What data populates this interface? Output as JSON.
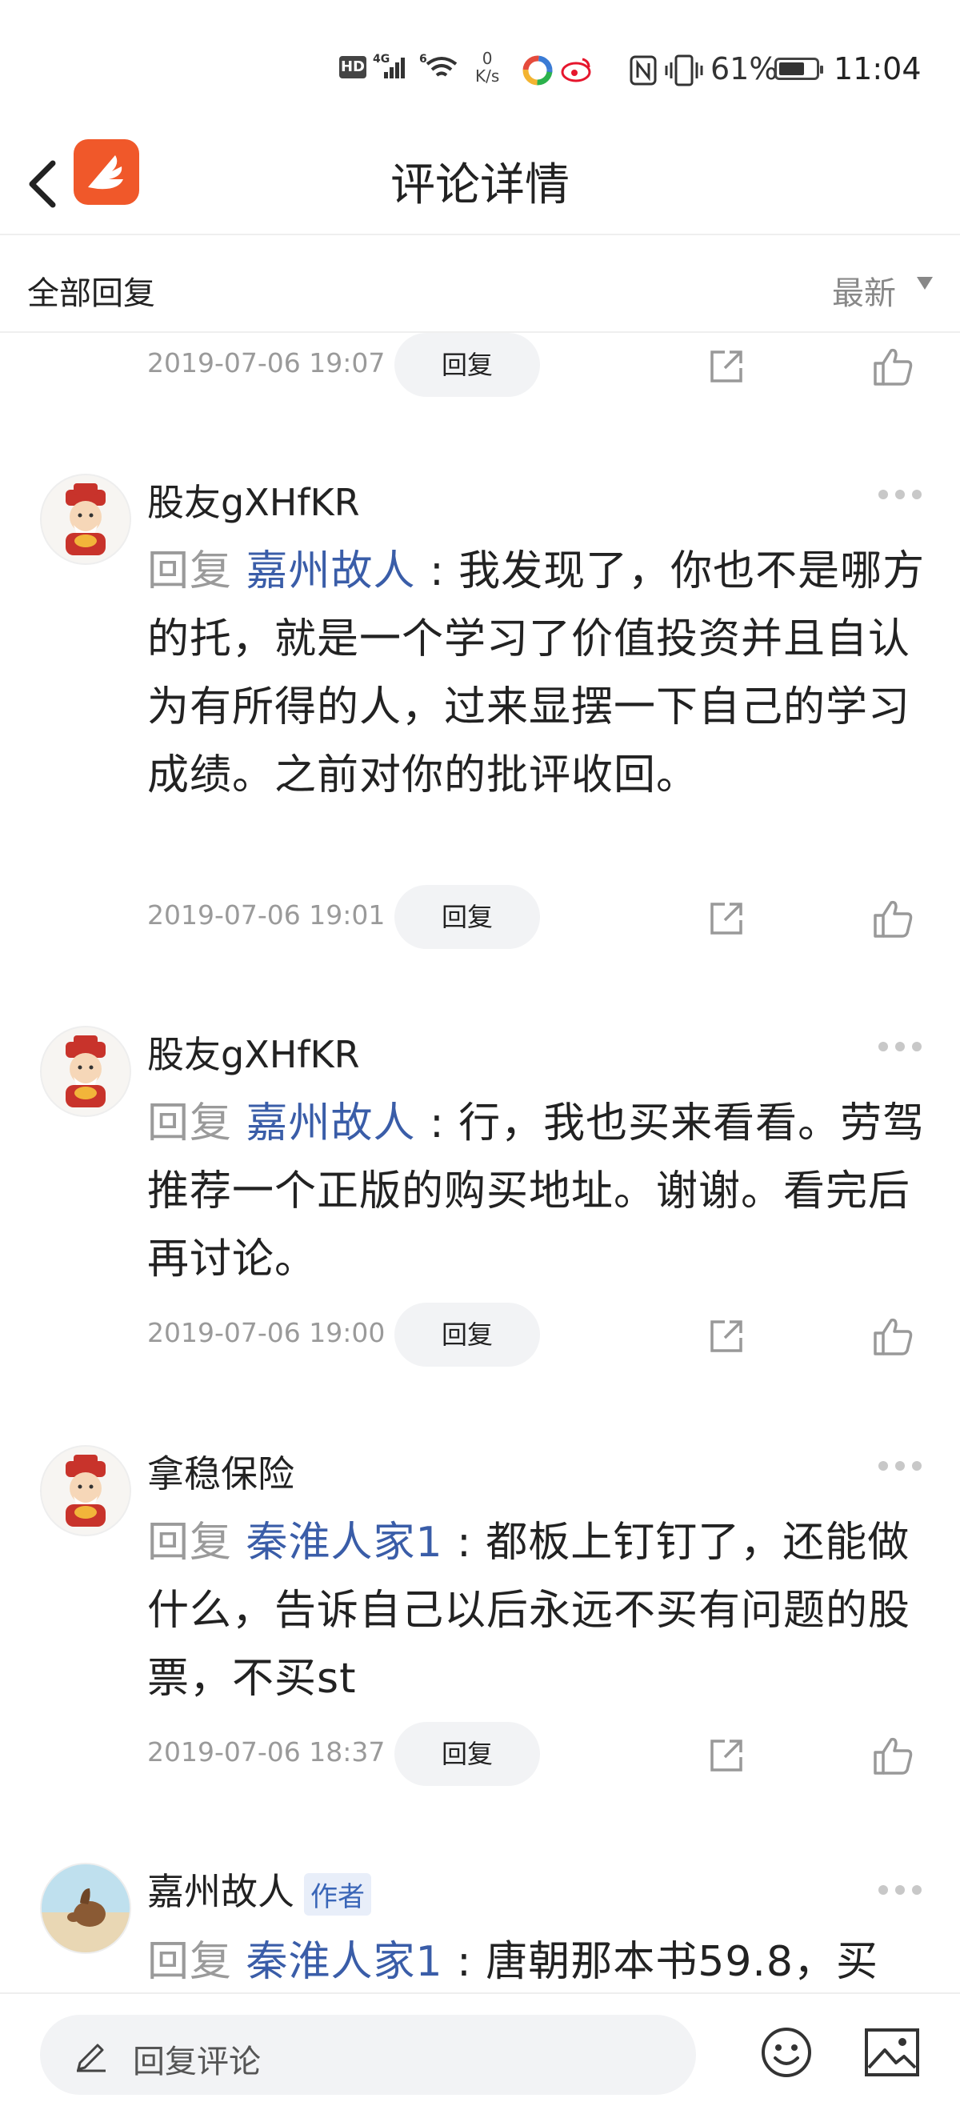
{
  "status_bar": {
    "hd": "HD",
    "network": "4G",
    "network2": "6",
    "speed_value": "0",
    "speed_unit": "K/s",
    "battery_pct": "61%",
    "battery_level": 0.61,
    "time": "11:04"
  },
  "header": {
    "title": "评论详情",
    "back_icon": "chevron-left-icon",
    "logo_icon": "app-logo-icon"
  },
  "filter": {
    "all_replies": "全部回复",
    "sort_label": "最新"
  },
  "partial_comment": {
    "timestamp": "2019-07-06 19:07",
    "reply_label": "回复"
  },
  "comments": [
    {
      "username": "股友gXHfKR",
      "reply_prefix": "回复",
      "mention": "嘉州故人",
      "separator": ":",
      "text": "我发现了，你也不是哪方的托，就是一个学习了价值投资并且自认为有所得的人，过来显摆一下自己的学习成绩。之前对你的批评收回。",
      "timestamp": "2019-07-06 19:01",
      "reply_label": "回复"
    },
    {
      "username": "股友gXHfKR",
      "reply_prefix": "回复",
      "mention": "嘉州故人",
      "separator": ":",
      "text": "行，我也买来看看。劳驾推荐一个正版的购买地址。谢谢。看完后再讨论。",
      "timestamp": "2019-07-06 19:00",
      "reply_label": "回复"
    },
    {
      "username": "拿稳保险",
      "reply_prefix": "回复",
      "mention": "秦淮人家1",
      "separator": ":",
      "text": "都板上钉钉了，还能做什么，告诉自己以后永远不买有问题的股票，不买st",
      "timestamp": "2019-07-06 18:37",
      "reply_label": "回复"
    },
    {
      "username": "嘉州故人",
      "author_badge": "作者",
      "reply_prefix": "回复",
      "mention": "秦淮人家1",
      "separator": ":",
      "text": "唐朝那本书59.8，买"
    }
  ],
  "bottom_bar": {
    "input_placeholder": "回复评论",
    "emoji_icon": "emoji-icon",
    "image_icon": "image-icon"
  },
  "colors": {
    "mention": "#3a5da8",
    "muted": "#9a9a9a",
    "logo": "#f0582a",
    "reply_button_bg": "#f2f3f5"
  }
}
